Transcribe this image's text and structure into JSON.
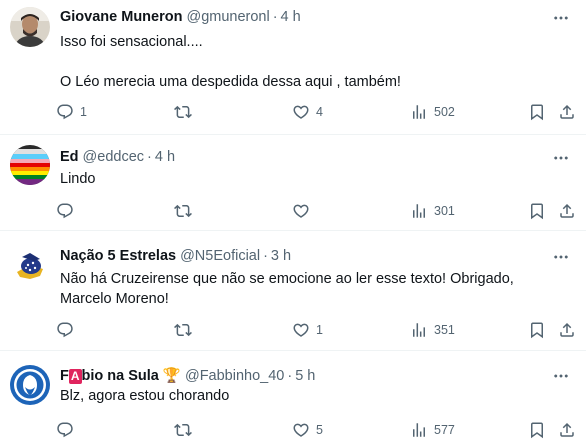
{
  "tweets": [
    {
      "display_name": "Giovane Muneron",
      "handle": "@gmuneronl",
      "dot": "·",
      "time": "4 h",
      "lines": [
        "Isso foi sensacional....",
        "",
        "O Léo merecia uma despedida dessa aqui , também!"
      ],
      "replies": "1",
      "retweets": "",
      "likes": "4",
      "views": "502"
    },
    {
      "display_name": "Ed",
      "handle": "@eddcec",
      "dot": "·",
      "time": "4 h",
      "lines": [
        "Lindo"
      ],
      "replies": "",
      "retweets": "",
      "likes": "",
      "views": "301"
    },
    {
      "display_name": "Nação 5 Estrelas",
      "handle": "@N5Eoficial",
      "dot": "·",
      "time": "3 h",
      "lines": [
        "Não há Cruzeirense que não se emocione ao ler esse texto! Obrigado,",
        "Marcelo Moreno!"
      ],
      "replies": "",
      "retweets": "",
      "likes": "1",
      "views": "351"
    },
    {
      "display_name_prefix": "F",
      "display_name_badge": "A",
      "display_name_rest": "bio na Sula",
      "display_name_emoji": "🏆",
      "handle": "@Fabbinho_40",
      "dot": "·",
      "time": "5 h",
      "lines": [
        "Blz, agora estou chorando"
      ],
      "replies": "",
      "retweets": "",
      "likes": "5",
      "views": "577"
    }
  ],
  "icons": {
    "reply": "reply-icon",
    "retweet": "retweet-icon",
    "like": "heart-icon",
    "views": "views-icon",
    "bookmark": "bookmark-icon",
    "share": "share-icon",
    "more": "more-icon"
  },
  "colors": {
    "text": "#0f1419",
    "muted": "#536471",
    "divider": "#eff3f4"
  }
}
